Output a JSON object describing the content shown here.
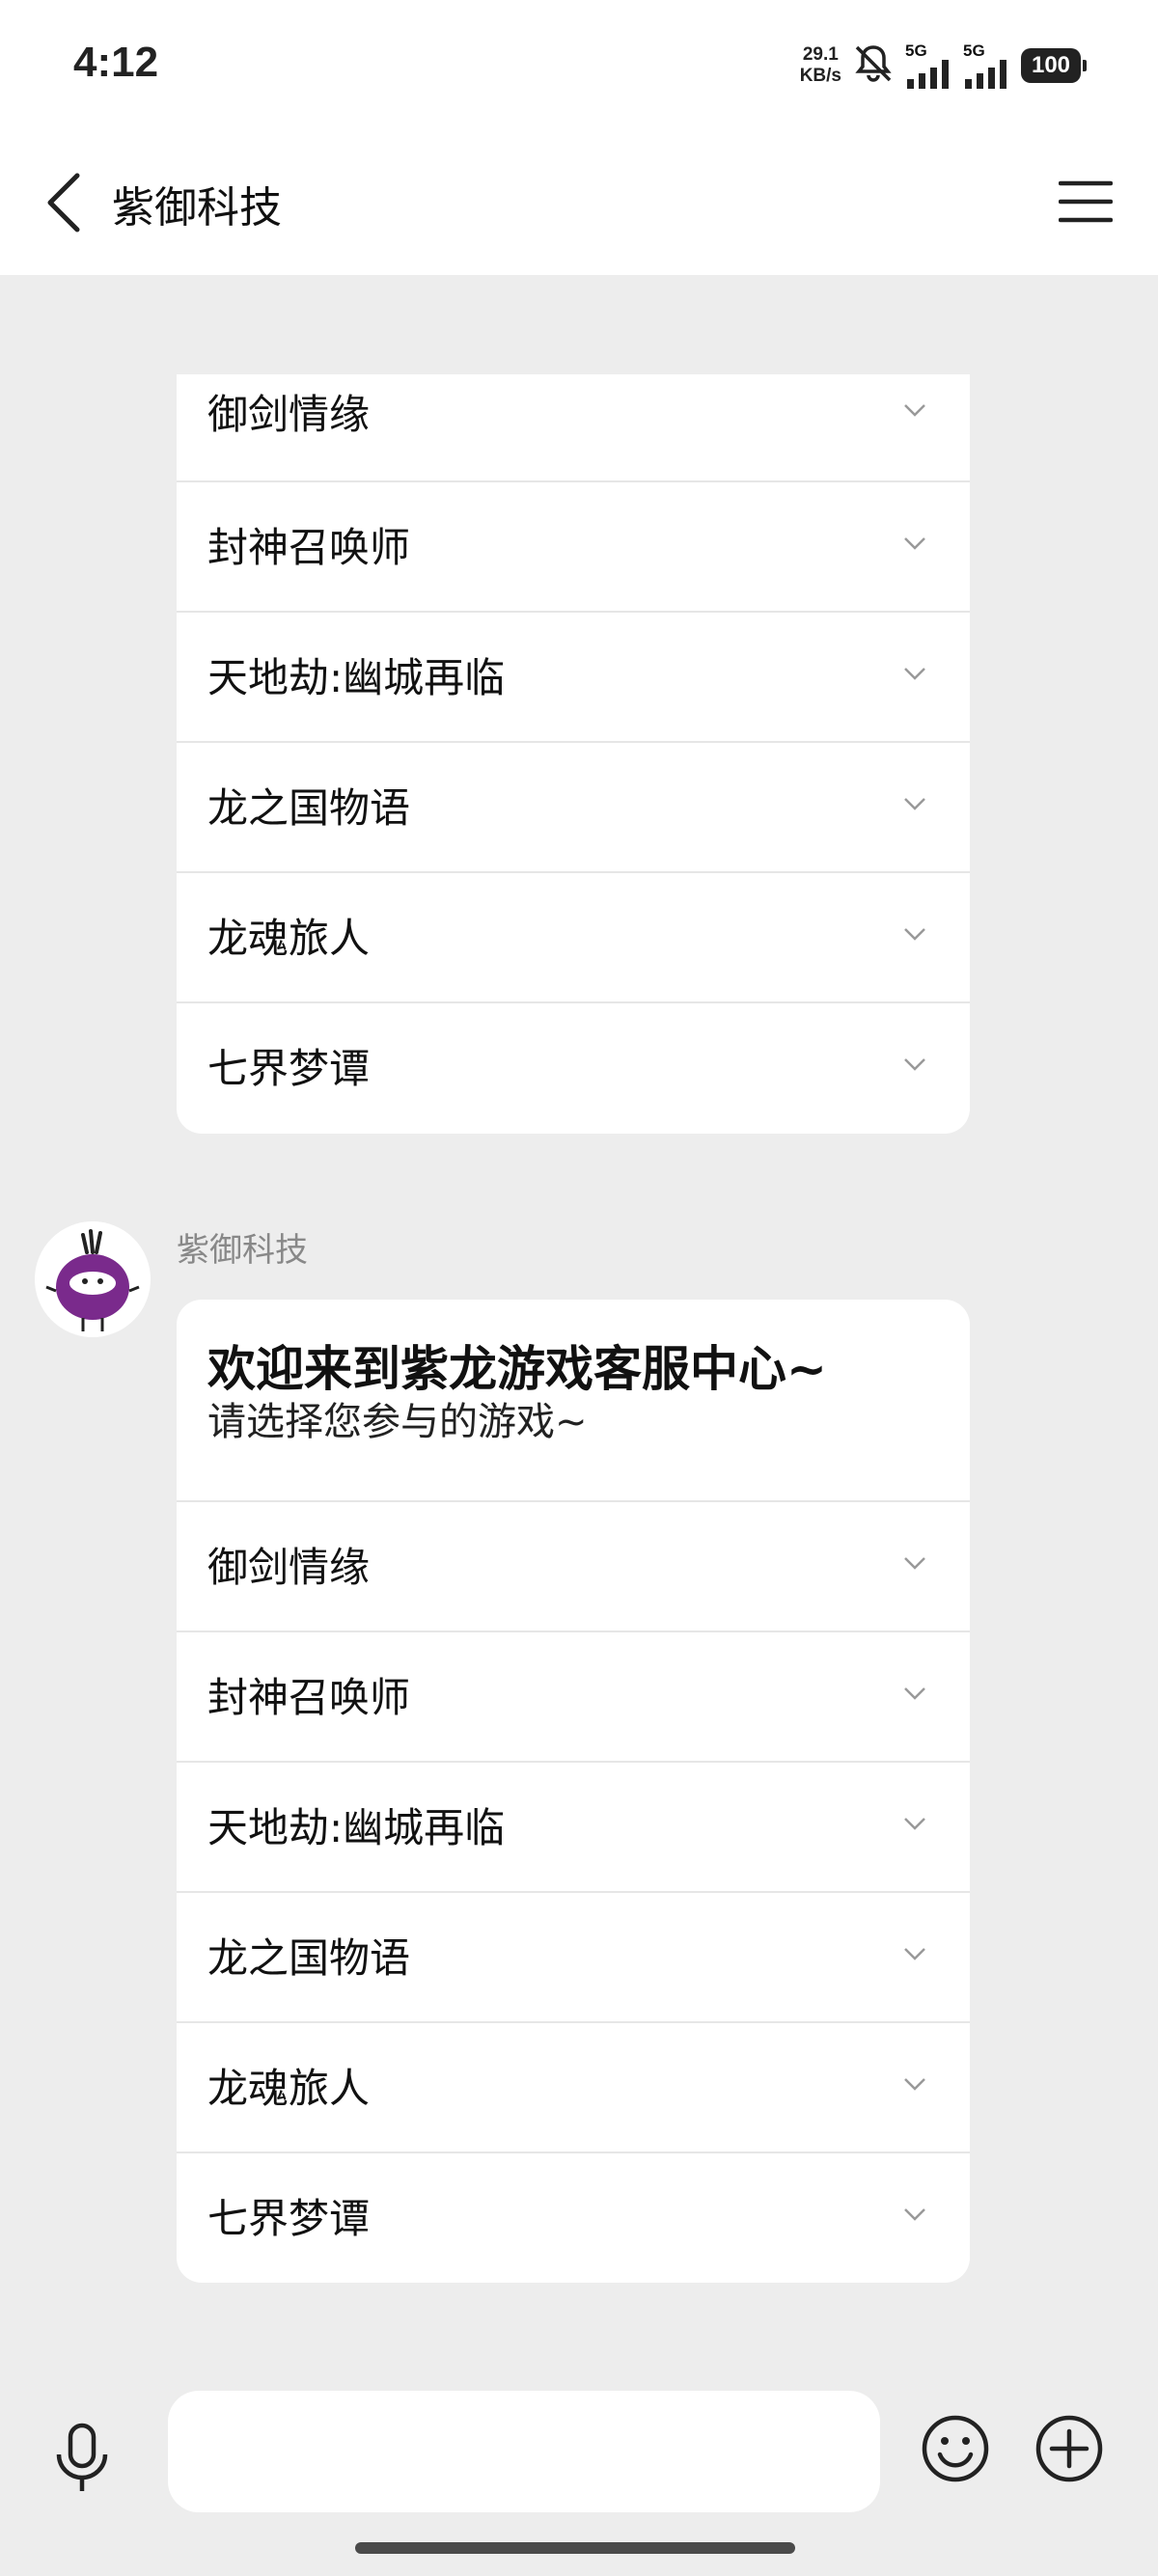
{
  "status": {
    "time": "4:12",
    "speed_value": "29.1",
    "speed_unit": "KB/s",
    "sim1": "5G",
    "sim2": "5G",
    "battery": "100"
  },
  "header": {
    "title": "紫御科技"
  },
  "previous_card": {
    "options": [
      "御剑情缘",
      "封神召唤师",
      "天地劫:幽城再临",
      "龙之国物语",
      "龙魂旅人",
      "七界梦谭"
    ]
  },
  "message": {
    "sender": "紫御科技",
    "heading": "欢迎来到紫龙游戏客服中心~",
    "subheading": "请选择您参与的游戏~",
    "options": [
      "御剑情缘",
      "封神召唤师",
      "天地劫:幽城再临",
      "龙之国物语",
      "龙魂旅人",
      "七界梦谭"
    ]
  },
  "input": {
    "value": ""
  },
  "colors": {
    "background": "#ededed",
    "avatar_purple": "#7a2a8c"
  }
}
